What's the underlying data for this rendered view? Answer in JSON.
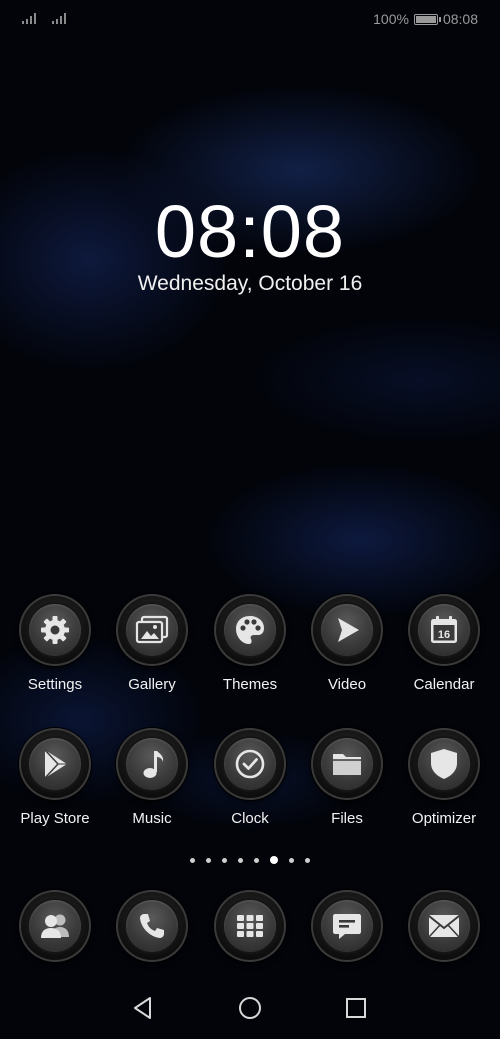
{
  "status_bar": {
    "battery_percent": "100%",
    "time": "08:08",
    "icons": [
      "signal-icon",
      "signal-icon",
      "battery-icon"
    ]
  },
  "lockclock": {
    "time": "08:08",
    "date": "Wednesday, October 16"
  },
  "apps_row1": [
    {
      "label": "Settings",
      "icon": "gear-icon"
    },
    {
      "label": "Gallery",
      "icon": "gallery-icon"
    },
    {
      "label": "Themes",
      "icon": "palette-icon"
    },
    {
      "label": "Video",
      "icon": "play-icon"
    },
    {
      "label": "Calendar",
      "icon": "calendar-icon",
      "badge": "16"
    }
  ],
  "apps_row2": [
    {
      "label": "Play Store",
      "icon": "play-store-icon"
    },
    {
      "label": "Music",
      "icon": "music-note-icon"
    },
    {
      "label": "Clock",
      "icon": "clock-check-icon"
    },
    {
      "label": "Files",
      "icon": "folder-icon"
    },
    {
      "label": "Optimizer",
      "icon": "shield-icon"
    }
  ],
  "page_indicator": {
    "count": 8,
    "active_index": 5
  },
  "dock": [
    {
      "icon": "contacts-icon"
    },
    {
      "icon": "phone-icon"
    },
    {
      "icon": "app-drawer-icon"
    },
    {
      "icon": "messages-icon"
    },
    {
      "icon": "mail-icon"
    }
  ],
  "nav": [
    "back-icon",
    "home-icon",
    "recents-icon"
  ],
  "colors": {
    "icon_glyph": "#e6e6e6",
    "label": "#f2f2f2",
    "background": "#02040a",
    "accent_blue": "#1e3778"
  }
}
